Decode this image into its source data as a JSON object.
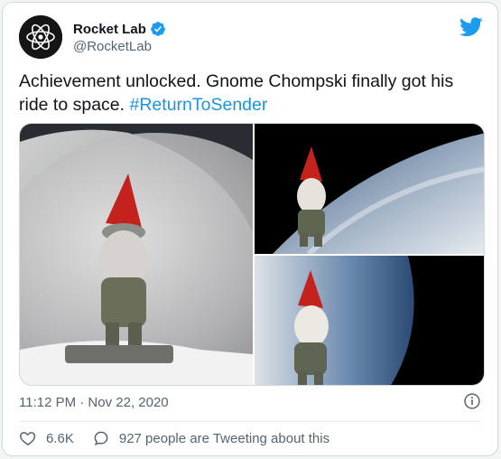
{
  "tweet": {
    "display_name": "Rocket Lab",
    "handle": "@RocketLab",
    "text": "Achievement unlocked. Gnome Chompski finally got his ride to space.",
    "hashtag": "#ReturnToSender",
    "timestamp": "11:12 PM · Nov 22, 2020",
    "likes": "6.6K",
    "talking": "927 people are Tweeting about this"
  },
  "icons": {
    "avatar": "rocket-lab-atom-logo",
    "verified": "verified-badge-icon",
    "brand": "twitter-bird-icon",
    "info": "info-icon",
    "like": "heart-icon",
    "talk": "speech-bubble-icon"
  },
  "colors": {
    "accent": "#1d9bf0",
    "hashtag": "#1b95e0",
    "secondary_text": "#536471",
    "border": "#cfd9de"
  },
  "media": {
    "images": [
      "gnome-earth-photo-left",
      "gnome-earth-photo-top-right",
      "gnome-earth-photo-bottom-right"
    ]
  }
}
